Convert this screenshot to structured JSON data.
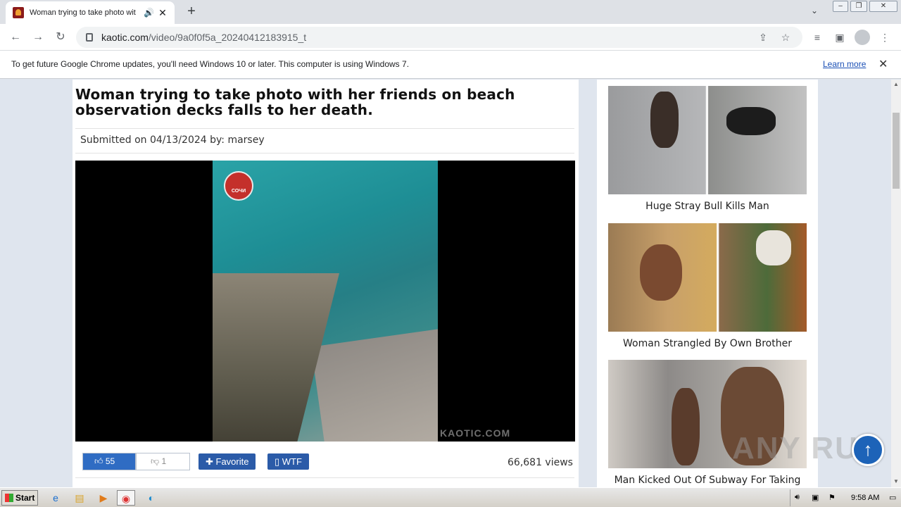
{
  "browser": {
    "tab_title": "Woman trying to take photo wit",
    "url_domain": "kaotic.com",
    "url_path": "/video/9a0f0f5a_20240412183915_t",
    "infobar_message": "To get future Google Chrome updates, you'll need Windows 10 or later. This computer is using Windows 7.",
    "infobar_link": "Learn more"
  },
  "article": {
    "headline": "Woman trying to take photo with her friends on beach observation decks falls to her death.",
    "submitted": "Submitted on 04/13/2024 by:  marsey",
    "video_logo_text": "СОЧИ",
    "video_watermark": "KAOTIC.COM",
    "likes": "55",
    "dislikes": "1",
    "favorite_label": "Favorite",
    "wtf_label": "WTF",
    "views": "66,681 views"
  },
  "sidebar": {
    "items": [
      {
        "title": "Huge Stray Bull Kills Man"
      },
      {
        "title": "Woman Strangled By Own Brother"
      },
      {
        "title": "Man Kicked Out Of Subway For Taking"
      }
    ]
  },
  "overlay": {
    "watermark": "ANY RUN"
  },
  "taskbar": {
    "start_label": "Start",
    "clock": "9:58 AM"
  },
  "colors": {
    "accent_blue": "#2b5ba8",
    "like_blue": "#2f6cc3",
    "page_bg": "#dfe5ee"
  }
}
